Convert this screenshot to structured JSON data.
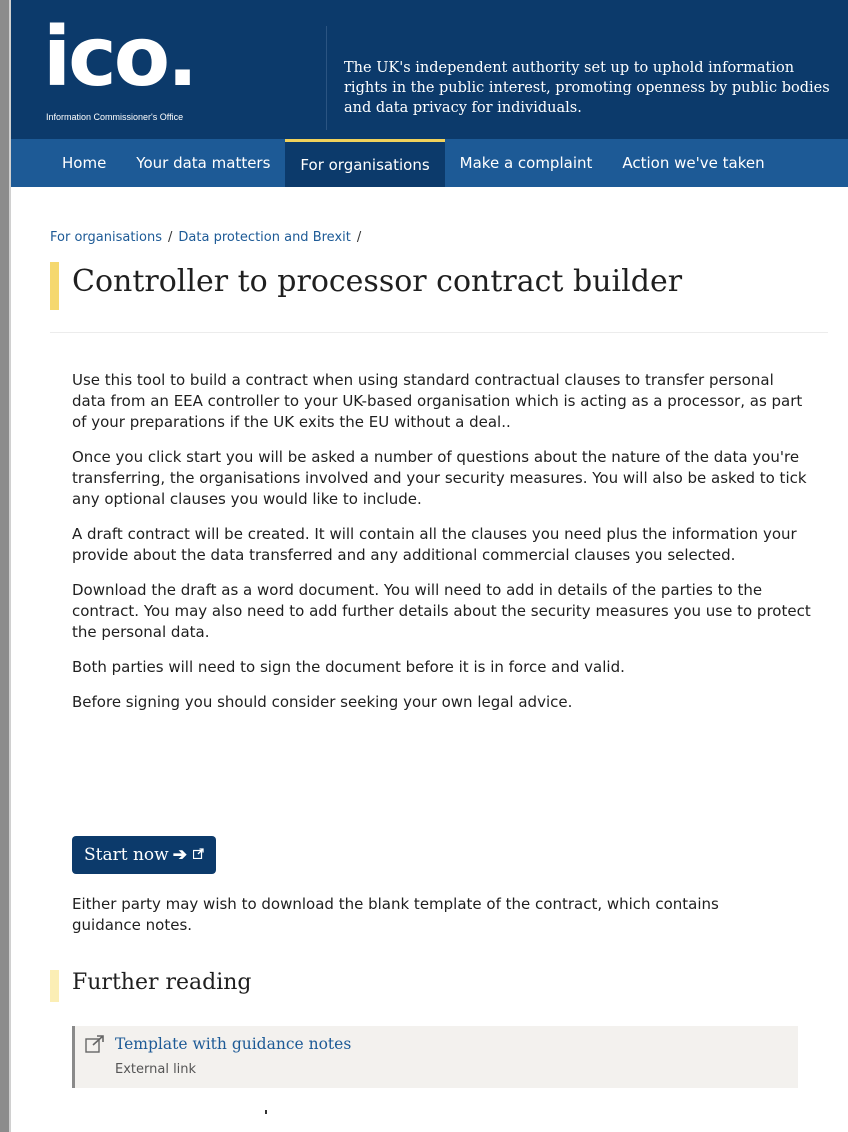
{
  "header": {
    "logo_text": "ico.",
    "logo_subtitle": "Information Commissioner's Office",
    "tagline": "The UK's independent authority set up to uphold information rights in the public interest, promoting openness by public bodies and data privacy for individuals."
  },
  "nav": {
    "items": [
      {
        "label": "Home"
      },
      {
        "label": "Your data matters"
      },
      {
        "label": "For organisations"
      },
      {
        "label": "Make a complaint"
      },
      {
        "label": "Action we've taken"
      }
    ]
  },
  "breadcrumb": {
    "items": [
      "For organisations",
      "Data protection and Brexit"
    ],
    "separator": "/"
  },
  "page": {
    "title": "Controller to processor contract builder",
    "paragraphs": [
      "Use this tool to build a contract when using standard contractual clauses to transfer personal data from an EEA controller to your UK-based organisation which is acting as a processor, as part of your preparations if the UK exits the EU without a deal..",
      "Once you click start you will be asked a number of questions about the nature of the data you're transferring, the organisations involved and your security measures. You will  also be asked to tick any optional clauses you would like to include.",
      "A draft contract will be created. It will contain all the clauses you need plus the information your provide about the data transferred and any additional commercial clauses you selected.",
      "Download the draft as a word document. You will need to add in details of the parties to the contract. You may also need to add further details about the security measures you use to protect the personal data.",
      "Both parties will need to sign the document before it is in force and valid.",
      "Before signing you should consider seeking your own legal advice."
    ],
    "start_button": {
      "label": "Start now",
      "arrow": "➔",
      "external_icon": "external-link-icon"
    },
    "after_text": " Either party may wish to download the blank template of the contract, which contains guidance notes."
  },
  "further_reading": {
    "title": "Further reading",
    "links": [
      {
        "title": "Template with guidance notes",
        "subtitle": "External link",
        "icon": "external-link-icon"
      }
    ]
  },
  "colors": {
    "header_bg": "#0c3a6b",
    "nav_bg": "#1d5a96",
    "accent_yellow": "#f5d86e",
    "link": "#1d5a96"
  }
}
